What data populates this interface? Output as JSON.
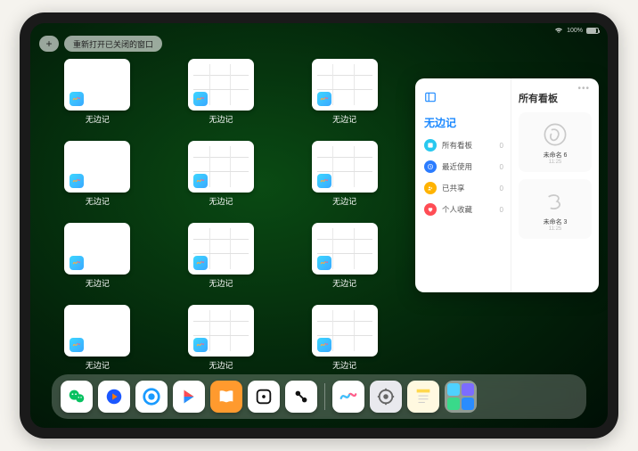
{
  "top": {
    "plus_glyph": "+",
    "reopen_label": "重新打开已关闭的窗口",
    "battery_text": "100%"
  },
  "app_label": "无边记",
  "thumbs": [
    {
      "lines": false
    },
    {
      "lines": true
    },
    {
      "lines": true
    },
    {
      "lines": false
    },
    {
      "lines": true
    },
    {
      "lines": true
    },
    {
      "lines": false
    },
    {
      "lines": true
    },
    {
      "lines": true
    },
    {
      "lines": false
    },
    {
      "lines": true
    },
    {
      "lines": true
    }
  ],
  "panel": {
    "title": "无边记",
    "right_title": "所有看板",
    "items": [
      {
        "label": "所有看板",
        "count": "0",
        "color": "#28c8ef"
      },
      {
        "label": "最近使用",
        "count": "0",
        "color": "#2b7cff"
      },
      {
        "label": "已共享",
        "count": "0",
        "color": "#ffb300"
      },
      {
        "label": "个人收藏",
        "count": "0",
        "color": "#ff4d55"
      }
    ],
    "boards": [
      {
        "name": "未命名 6",
        "date": "11:25"
      },
      {
        "name": "未命名 3",
        "date": "11:25"
      }
    ]
  },
  "dock": {
    "apps": [
      {
        "name": "wechat",
        "bg": "#ffffff"
      },
      {
        "name": "tencent-video",
        "bg": "#ffffff"
      },
      {
        "name": "qq-browser",
        "bg": "#ffffff"
      },
      {
        "name": "play",
        "bg": "#ffffff"
      },
      {
        "name": "books",
        "bg": "#ff9a2e"
      },
      {
        "name": "dice",
        "bg": "#ffffff"
      },
      {
        "name": "connect",
        "bg": "#ffffff"
      },
      {
        "name": "freeform",
        "bg": "#ffffff"
      },
      {
        "name": "settings",
        "bg": "#e9e9ee"
      },
      {
        "name": "notes",
        "bg": "#fff9e0"
      }
    ]
  }
}
